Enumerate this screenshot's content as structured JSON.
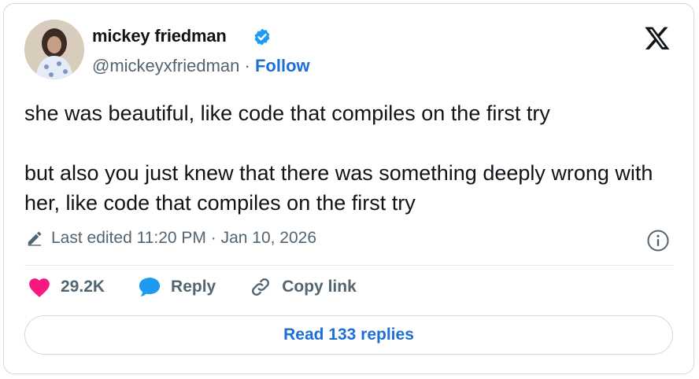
{
  "author": {
    "name": "mickey friedman",
    "handle": "@mickeyxfriedman",
    "separator": "·",
    "follow_label": "Follow"
  },
  "tweet": {
    "paragraph1": "she was beautiful, like code that compiles on the first try",
    "paragraph2": "but also you just knew that there was something deeply wrong with her, like code that compiles on the first try"
  },
  "meta": {
    "edited_label": "Last edited 11:20 PM · Jan 10, 2026"
  },
  "actions": {
    "likes": "29.2K",
    "reply_label": "Reply",
    "copy_label": "Copy link"
  },
  "read_replies_label": "Read 133 replies",
  "colors": {
    "link_blue": "#1d6fd6",
    "like_pink": "#f91880",
    "reply_blue": "#1d9bf0",
    "muted": "#536471",
    "verified_blue": "#1d9bf0"
  },
  "icons": [
    "verified-badge-icon",
    "x-logo-icon",
    "pencil-icon",
    "info-icon",
    "heart-icon",
    "speech-bubble-icon",
    "link-icon"
  ]
}
